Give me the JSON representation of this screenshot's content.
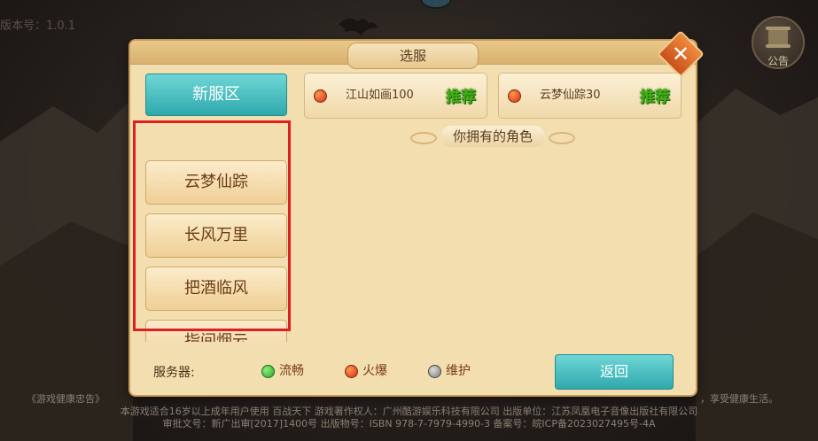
{
  "background": {
    "version_text": "版本号：1.0.1",
    "notice_label": "公告"
  },
  "dialog": {
    "title": "选服",
    "close_symbol": "✕",
    "new_zone_tab": "新服区",
    "regions": [
      "云梦仙踪",
      "长风万里",
      "把酒临风",
      "指间烟云"
    ],
    "servers": [
      {
        "name": "江山如画100",
        "tag": "推荐",
        "status_color": "#e0401c"
      },
      {
        "name": "云梦仙踪30",
        "tag": "推荐",
        "status_color": "#e0401c"
      }
    ],
    "roles_title": "你拥有的角色",
    "legend_label": "服务器:",
    "legend": [
      {
        "label": "流畅",
        "color": "#3ec03a"
      },
      {
        "label": "火爆",
        "color": "#e0401c"
      },
      {
        "label": "维护",
        "color": "#8a8a8a"
      }
    ],
    "return_button": "返回"
  },
  "footer": {
    "line1_left": "《游戏健康忠告》",
    "line1_right": "，享受健康生活。",
    "line2": "本游戏适合16岁以上成年用户使用 百战天下 游戏著作权人：广州酷游娱乐科技有限公司 出版单位：江苏凤凰电子音像出版社有限公司",
    "line3": "审批文号：新广出审[2017]1400号 出版物号：ISBN 978-7-7979-4990-3    备案号：皖ICP备2023027495号-4A"
  },
  "colors": {
    "accent_teal": "#2fa9ad",
    "highlight_red": "#e02020",
    "panel_bg": "#f3deb0"
  }
}
